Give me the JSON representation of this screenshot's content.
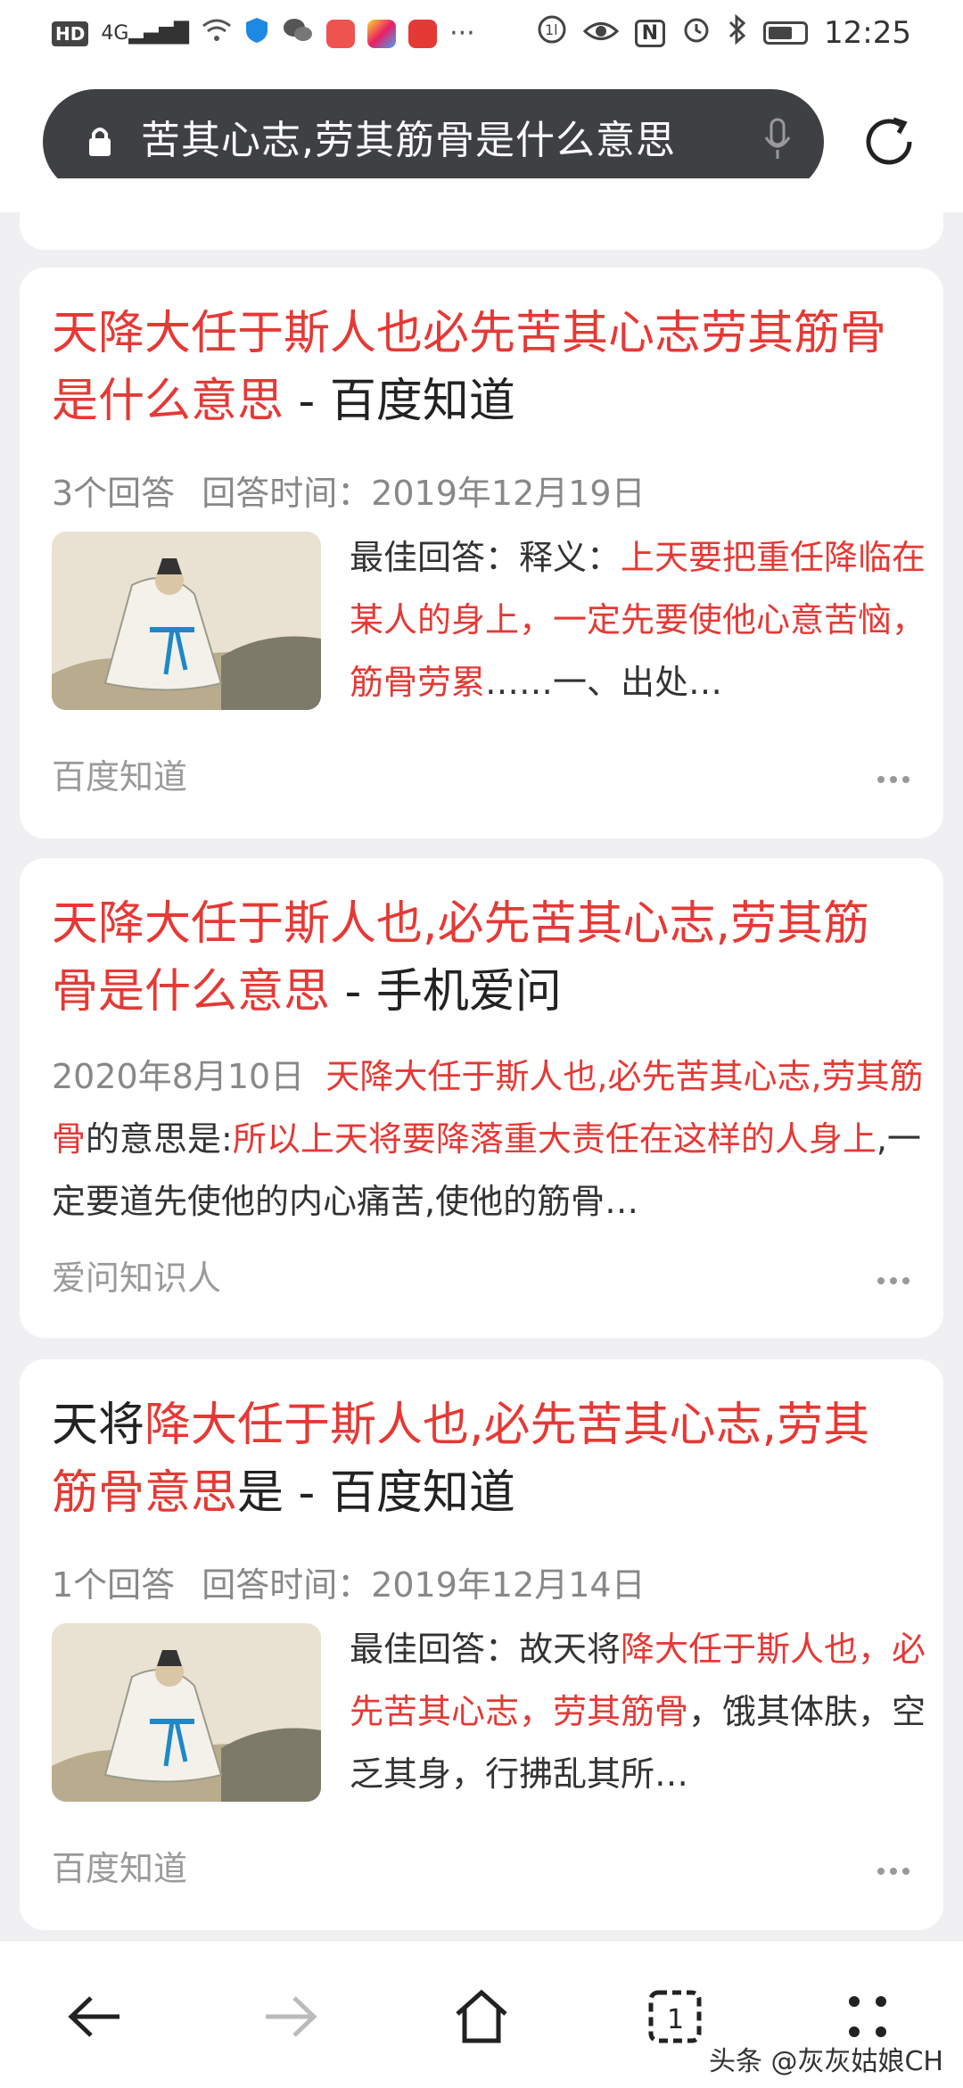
{
  "status_bar": {
    "network_badge": "HD",
    "signal_label": "4G",
    "time": "12:25",
    "nfc_label": "N"
  },
  "address_bar": {
    "query": "苦其心志,劳其筋骨是什么意思"
  },
  "results": [
    {
      "title_red": "天降大任于斯人也必先苦其心志劳其筋骨是什么意思",
      "title_sep": " - ",
      "title_site": "百度知道",
      "answers": "3个回答",
      "time_label": "回答时间：2019年12月19日",
      "snippet_prefix": "最佳回答：释义：",
      "snippet_red": "上天要把重任降临在某人的身上，一定先要使他心意苦恼，筋骨劳累",
      "snippet_rest": "……一、出处…",
      "source": "百度知道"
    },
    {
      "date": "2020年8月10日",
      "title_red": "天降大任于斯人也,必先苦其心志,劳其筋骨是什么意思",
      "title_sep": " - ",
      "title_site": "手机爱问",
      "snippet_red1": "天降大任于斯人也,必先苦其心志,劳其筋骨",
      "snippet_mid": "的意思是:",
      "snippet_red2": "所以上天将要降落重大责任在这样的人身上",
      "snippet_rest": ",一定要道先使他的内心痛苦,使他的筋骨…",
      "source": "爱问知识人"
    },
    {
      "title_black1": "天将",
      "title_red": "降大任于斯人也,必先苦其心志,劳其筋骨意思",
      "title_black2": "是",
      "title_sep": " - ",
      "title_site": "百度知道",
      "answers": "1个回答",
      "time_label": "回答时间：2019年12月14日",
      "snippet_prefix": "最佳回答：故天将",
      "snippet_red": "降大任于斯人也，必先苦其心志，劳其筋骨",
      "snippet_rest": "，饿其体肤，空乏其身，行拂乱其所…",
      "source": "百度知道"
    }
  ],
  "watermark": "头条 @灰灰姑娘CH",
  "colors": {
    "accent_red": "#e53935",
    "url_pill": "#3f4043"
  }
}
